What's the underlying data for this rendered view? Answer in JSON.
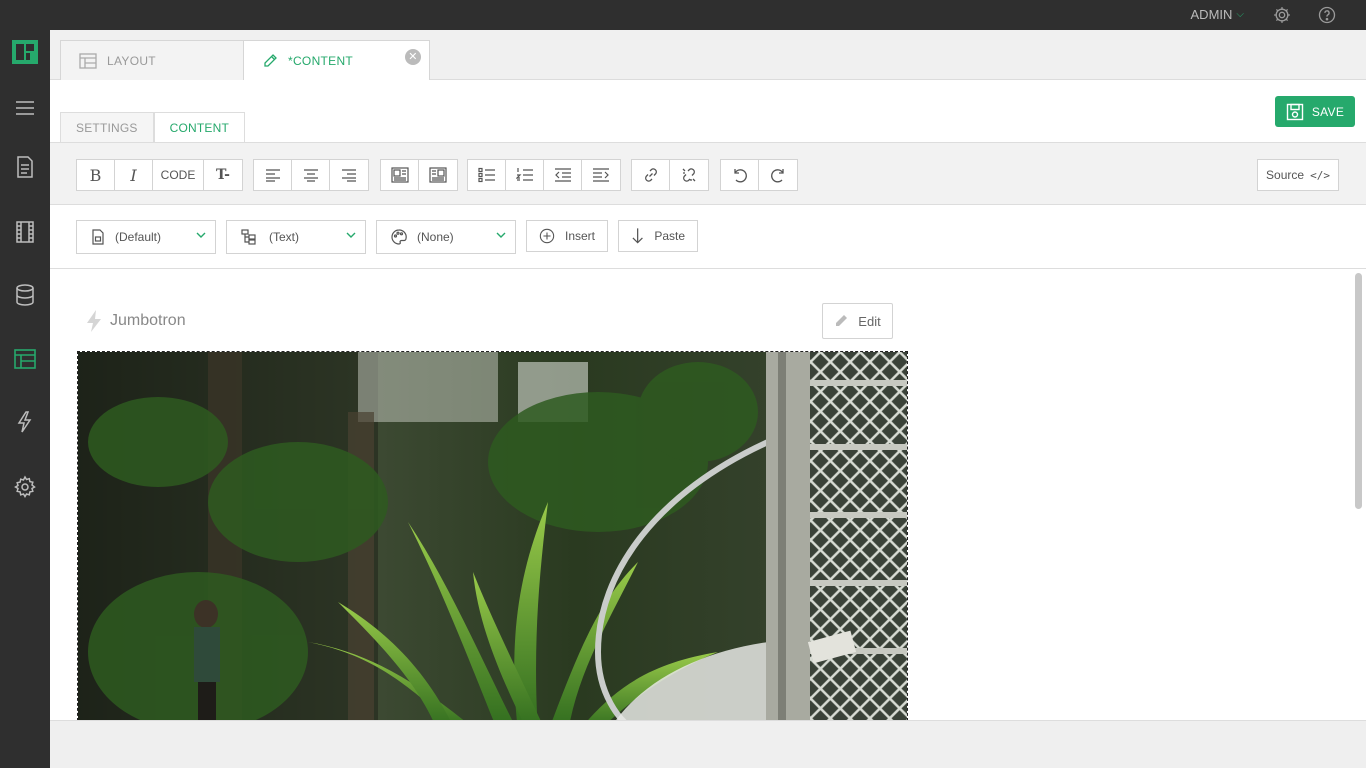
{
  "topbar": {
    "user_label": "ADMIN"
  },
  "doc_tabs": [
    {
      "label": "LAYOUT"
    },
    {
      "label": "*CONTENT"
    }
  ],
  "sub_tabs": [
    {
      "label": "SETTINGS"
    },
    {
      "label": "CONTENT"
    }
  ],
  "toolbar": {
    "save_label": "SAVE",
    "code_label": "CODE",
    "source_label": "Source",
    "source_icon_text": "</>"
  },
  "format_row": {
    "style_select": "(Default)",
    "element_select": "(Text)",
    "theme_select": "(None)",
    "insert_label": "Insert",
    "paste_label": "Paste"
  },
  "block": {
    "title": "Jumbotron",
    "edit_label": "Edit"
  },
  "colors": {
    "accent": "#26a96c",
    "sidebar_bg": "#2f2f2f",
    "panel_bg": "#f0f0f0"
  }
}
